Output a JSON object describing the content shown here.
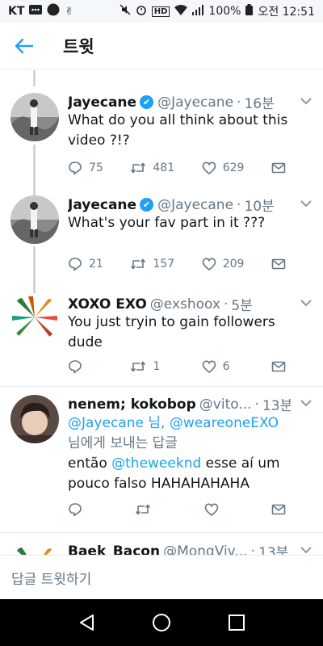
{
  "status_bar": {
    "carrier": "KT",
    "battery": "100%",
    "time": "오전 12:51"
  },
  "header": {
    "title": "트윗"
  },
  "tweets": [
    {
      "name": "Jayecane",
      "handle": "@Jayecane",
      "time": "16분",
      "text": "What do you all think about this video ?!?",
      "replies": "75",
      "retweets": "481",
      "likes": "629"
    },
    {
      "name": "Jayecane",
      "handle": "@Jayecane",
      "time": "10분",
      "text": "What's your fav part in it ???",
      "replies": "21",
      "retweets": "157",
      "likes": "209"
    },
    {
      "name": "XOXO EXO",
      "handle": "@exshoox",
      "time": "5분",
      "text": "You just tryin to gain followers dude",
      "replies": "",
      "retweets": "1",
      "likes": "6"
    },
    {
      "name": "nenem; kokobop",
      "handle": "@vito...",
      "time": "13분",
      "mention_1": "@Jayecane",
      "mention_1_suffix": " 님, ",
      "mention_2": "@weareoneEXO",
      "reply_to_suffix": "님에게 보내는 답글",
      "text_prefix": "então ",
      "mention_3": "@theweeknd",
      "text_suffix": " esse aí um pouco falso HAHAHAHAHA",
      "replies": "",
      "retweets": "",
      "likes": ""
    },
    {
      "name": "Baek_Bacon",
      "handle": "@MongViv...",
      "time": "13분"
    }
  ],
  "reply_bar": {
    "placeholder": "답글 트윗하기"
  },
  "colors": {
    "accent": "#1da1f2",
    "muted": "#657786",
    "thread_line": "#ccd6dd"
  }
}
